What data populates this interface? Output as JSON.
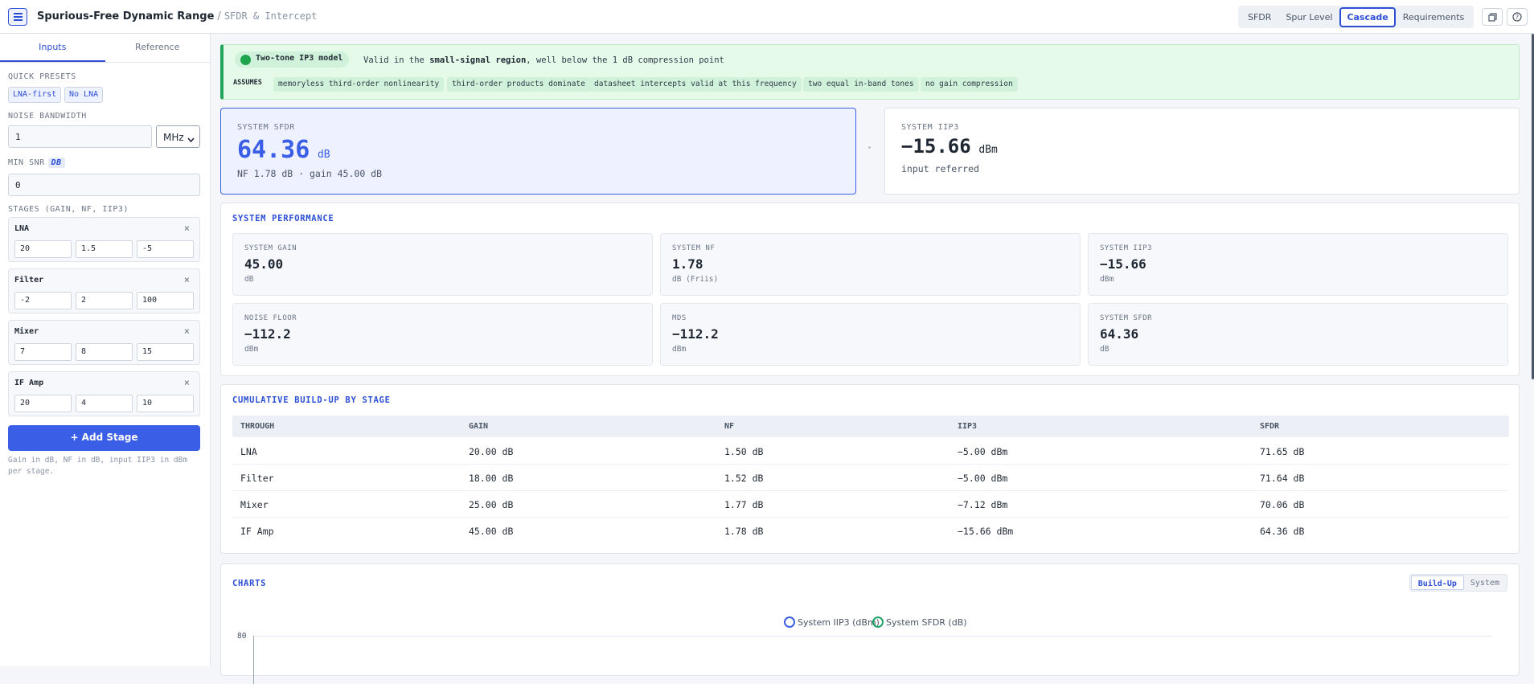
{
  "header": {
    "title": "Spurious‑Free Dynamic Range",
    "separator": "/",
    "subtitle": "SFDR & Intercept",
    "tabs": [
      "SFDR",
      "Spur Level",
      "Cascade",
      "Requirements"
    ],
    "active_tab": "Cascade"
  },
  "sidebar": {
    "tabs": [
      "Inputs",
      "Reference"
    ],
    "quick_presets_label": "QUICK PRESETS",
    "presets": [
      "LNA-first",
      "No LNA"
    ],
    "noise_bw_label": "NOISE BANDWIDTH",
    "noise_bw_value": "1",
    "noise_bw_unit": "MHz",
    "min_snr_label": "MIN SNR",
    "min_snr_unit": "DB",
    "min_snr_value": "0",
    "stages_label": "STAGES (GAIN, NF, IIP3)",
    "stages": [
      {
        "name": "LNA",
        "gain": "20",
        "nf": "1.5",
        "iip3": "-5"
      },
      {
        "name": "Filter",
        "gain": "-2",
        "nf": "2",
        "iip3": "100"
      },
      {
        "name": "Mixer",
        "gain": "7",
        "nf": "8",
        "iip3": "15"
      },
      {
        "name": "IF Amp",
        "gain": "20",
        "nf": "4",
        "iip3": "10"
      }
    ],
    "remove_glyph": "×",
    "add_stage": "+ Add Stage",
    "hint": "Gain in dB, NF in dB, input IIP3 in dBm per stage."
  },
  "assumptions": {
    "badge": "Two-tone IP3 model",
    "valid_prefix": "Valid in the",
    "valid_bold": "small-signal region",
    "valid_suffix": ", well below the 1 dB compression point",
    "label": "ASSUMES",
    "chips": [
      "memoryless third-order nonlinearity",
      "third-order products dominate",
      "datasheet intercepts valid at this frequency",
      "two equal in-band tones",
      "no gain compression"
    ]
  },
  "kpi": {
    "sfdr_label": "SYSTEM SFDR",
    "sfdr_value": "64.36",
    "sfdr_unit": "dB",
    "sfdr_sub": "NF 1.78 dB · gain 45.00 dB",
    "iip3_label": "SYSTEM IIP3",
    "iip3_value": "−15.66",
    "iip3_unit": "dBm",
    "iip3_sub": "input referred"
  },
  "performance": {
    "title": "SYSTEM PERFORMANCE",
    "metrics": [
      {
        "label": "SYSTEM GAIN",
        "value": "45.00",
        "unit": "dB"
      },
      {
        "label": "SYSTEM NF",
        "value": "1.78",
        "unit": "dB (Friis)"
      },
      {
        "label": "SYSTEM IIP3",
        "value": "−15.66",
        "unit": "dBm"
      },
      {
        "label": "NOISE FLOOR",
        "value": "−112.2",
        "unit": "dBm"
      },
      {
        "label": "MDS",
        "value": "−112.2",
        "unit": "dBm"
      },
      {
        "label": "SYSTEM SFDR",
        "value": "64.36",
        "unit": "dB"
      }
    ]
  },
  "buildup": {
    "title": "CUMULATIVE BUILD-UP BY STAGE",
    "columns": [
      "THROUGH",
      "GAIN",
      "NF",
      "IIP3",
      "SFDR"
    ],
    "rows": [
      [
        "LNA",
        "20.00 dB",
        "1.50 dB",
        "−5.00 dBm",
        "71.65 dB"
      ],
      [
        "Filter",
        "18.00 dB",
        "1.52 dB",
        "−5.00 dBm",
        "71.64 dB"
      ],
      [
        "Mixer",
        "25.00 dB",
        "1.77 dB",
        "−7.12 dBm",
        "70.06 dB"
      ],
      [
        "IF Amp",
        "45.00 dB",
        "1.78 dB",
        "−15.66 dBm",
        "64.36 dB"
      ]
    ]
  },
  "charts": {
    "title": "CHARTS",
    "toggle": [
      "Build-Up",
      "System"
    ],
    "legend": [
      "System IIP3 (dBm)",
      "System SFDR (dB)"
    ],
    "series_colors": [
      "#3a5ee6",
      "#1fa56a"
    ],
    "y_tick_visible": "80"
  }
}
